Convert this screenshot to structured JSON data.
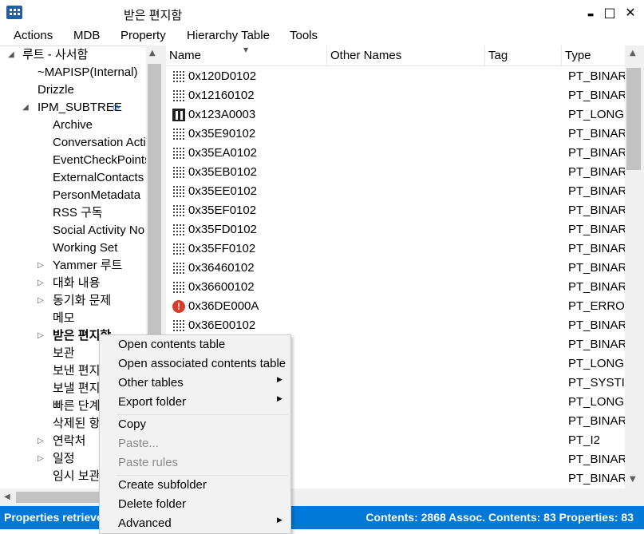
{
  "window": {
    "title": "받은 편지함",
    "minimize_glyph": "▬",
    "maximize_glyph": "□",
    "close_glyph": "✕",
    "icon": "app-grid-icon"
  },
  "menubar": {
    "items": [
      "Actions",
      "MDB",
      "Property",
      "Hierarchy Table",
      "Tools"
    ]
  },
  "tree": {
    "nodes": [
      {
        "label": "루트 - 사서함",
        "expander": "◢"
      },
      {
        "label": "~MAPISP(Internal)",
        "expander": ""
      },
      {
        "label": "Drizzle",
        "expander": ""
      },
      {
        "label": "IPM_SUBTREE",
        "expander": "◢",
        "badge": "sync-icon"
      },
      {
        "label": "Archive",
        "expander": ""
      },
      {
        "label": "Conversation Acti",
        "expander": ""
      },
      {
        "label": "EventCheckPoints",
        "expander": ""
      },
      {
        "label": "ExternalContacts",
        "expander": ""
      },
      {
        "label": "PersonMetadata",
        "expander": ""
      },
      {
        "label": "RSS 구독",
        "expander": ""
      },
      {
        "label": "Social Activity No",
        "expander": ""
      },
      {
        "label": "Working Set",
        "expander": ""
      },
      {
        "label": "Yammer 루트",
        "expander": "▷"
      },
      {
        "label": "대화 내용",
        "expander": "▷"
      },
      {
        "label": "동기화 문제",
        "expander": "▷"
      },
      {
        "label": "메모",
        "expander": ""
      },
      {
        "label": "받은 편지함",
        "expander": "▷"
      },
      {
        "label": "보관",
        "expander": ""
      },
      {
        "label": "보낸 편지함",
        "expander": ""
      },
      {
        "label": "보낼 편지함",
        "expander": ""
      },
      {
        "label": "빠른 단계",
        "expander": ""
      },
      {
        "label": "삭제된 항목",
        "expander": ""
      },
      {
        "label": "연락처",
        "expander": "▷"
      },
      {
        "label": "일정",
        "expander": "▷"
      },
      {
        "label": "임시 보관함",
        "expander": ""
      }
    ]
  },
  "list": {
    "columns": [
      "Name",
      "Other Names",
      "Tag",
      "Type"
    ],
    "rows": [
      {
        "name": "0x120D0102",
        "type": "PT_BINARY",
        "icon": "binary-icon"
      },
      {
        "name": "0x12160102",
        "type": "PT_BINARY",
        "icon": "binary-icon"
      },
      {
        "name": "0x123A0003",
        "type": "PT_LONG",
        "icon": "long-icon"
      },
      {
        "name": "0x35E90102",
        "type": "PT_BINARY",
        "icon": "binary-icon"
      },
      {
        "name": "0x35EA0102",
        "type": "PT_BINARY",
        "icon": "binary-icon"
      },
      {
        "name": "0x35EB0102",
        "type": "PT_BINARY",
        "icon": "binary-icon"
      },
      {
        "name": "0x35EE0102",
        "type": "PT_BINARY",
        "icon": "binary-icon"
      },
      {
        "name": "0x35EF0102",
        "type": "PT_BINARY",
        "icon": "binary-icon"
      },
      {
        "name": "0x35FD0102",
        "type": "PT_BINARY",
        "icon": "binary-icon"
      },
      {
        "name": "0x35FF0102",
        "type": "PT_BINARY",
        "icon": "binary-icon"
      },
      {
        "name": "0x36460102",
        "type": "PT_BINARY",
        "icon": "binary-icon"
      },
      {
        "name": "0x36600102",
        "type": "PT_BINARY",
        "icon": "binary-icon"
      },
      {
        "name": "0x36DE000A",
        "type": "PT_ERROR",
        "icon": "error-icon"
      },
      {
        "name": "0x36E00102",
        "type": "PT_BINARY",
        "icon": "binary-icon"
      },
      {
        "name": "",
        "type": "PT_BINARY",
        "icon": ""
      },
      {
        "name": "",
        "type": "PT_LONG",
        "icon": ""
      },
      {
        "name": "",
        "type": "PT_SYSTIME",
        "icon": ""
      },
      {
        "name": "",
        "type": "PT_LONG",
        "icon": ""
      },
      {
        "name": "",
        "type": "PT_BINARY",
        "icon": ""
      },
      {
        "name": "",
        "type": "PT_I2",
        "icon": ""
      },
      {
        "name": "",
        "type": "PT_BINARY",
        "icon": ""
      },
      {
        "name": "",
        "type": "PT_BINARY",
        "icon": ""
      }
    ]
  },
  "context_menu": {
    "items": [
      {
        "label": "Open contents table",
        "enabled": true,
        "submenu": false
      },
      {
        "label": "Open associated contents table",
        "enabled": true,
        "submenu": false
      },
      {
        "label": "Other tables",
        "enabled": true,
        "submenu": true
      },
      {
        "label": "Export folder",
        "enabled": true,
        "submenu": true
      },
      {
        "label": "Copy",
        "enabled": true,
        "submenu": false
      },
      {
        "label": "Paste...",
        "enabled": false,
        "submenu": false
      },
      {
        "label": "Paste rules",
        "enabled": false,
        "submenu": false
      },
      {
        "label": "Create subfolder",
        "enabled": true,
        "submenu": false
      },
      {
        "label": "Delete folder",
        "enabled": true,
        "submenu": false
      },
      {
        "label": "Advanced",
        "enabled": true,
        "submenu": true
      }
    ],
    "submenu_glyph": "▶"
  },
  "statusbar": {
    "left": "Properties retrieved",
    "right": "Contents: 2868 Assoc. Contents: 83  Properties: 83"
  },
  "colors": {
    "status_bg": "#0078d7",
    "error_icon": "#d93b2b",
    "scroll_thumb": "#c2c2c2"
  }
}
